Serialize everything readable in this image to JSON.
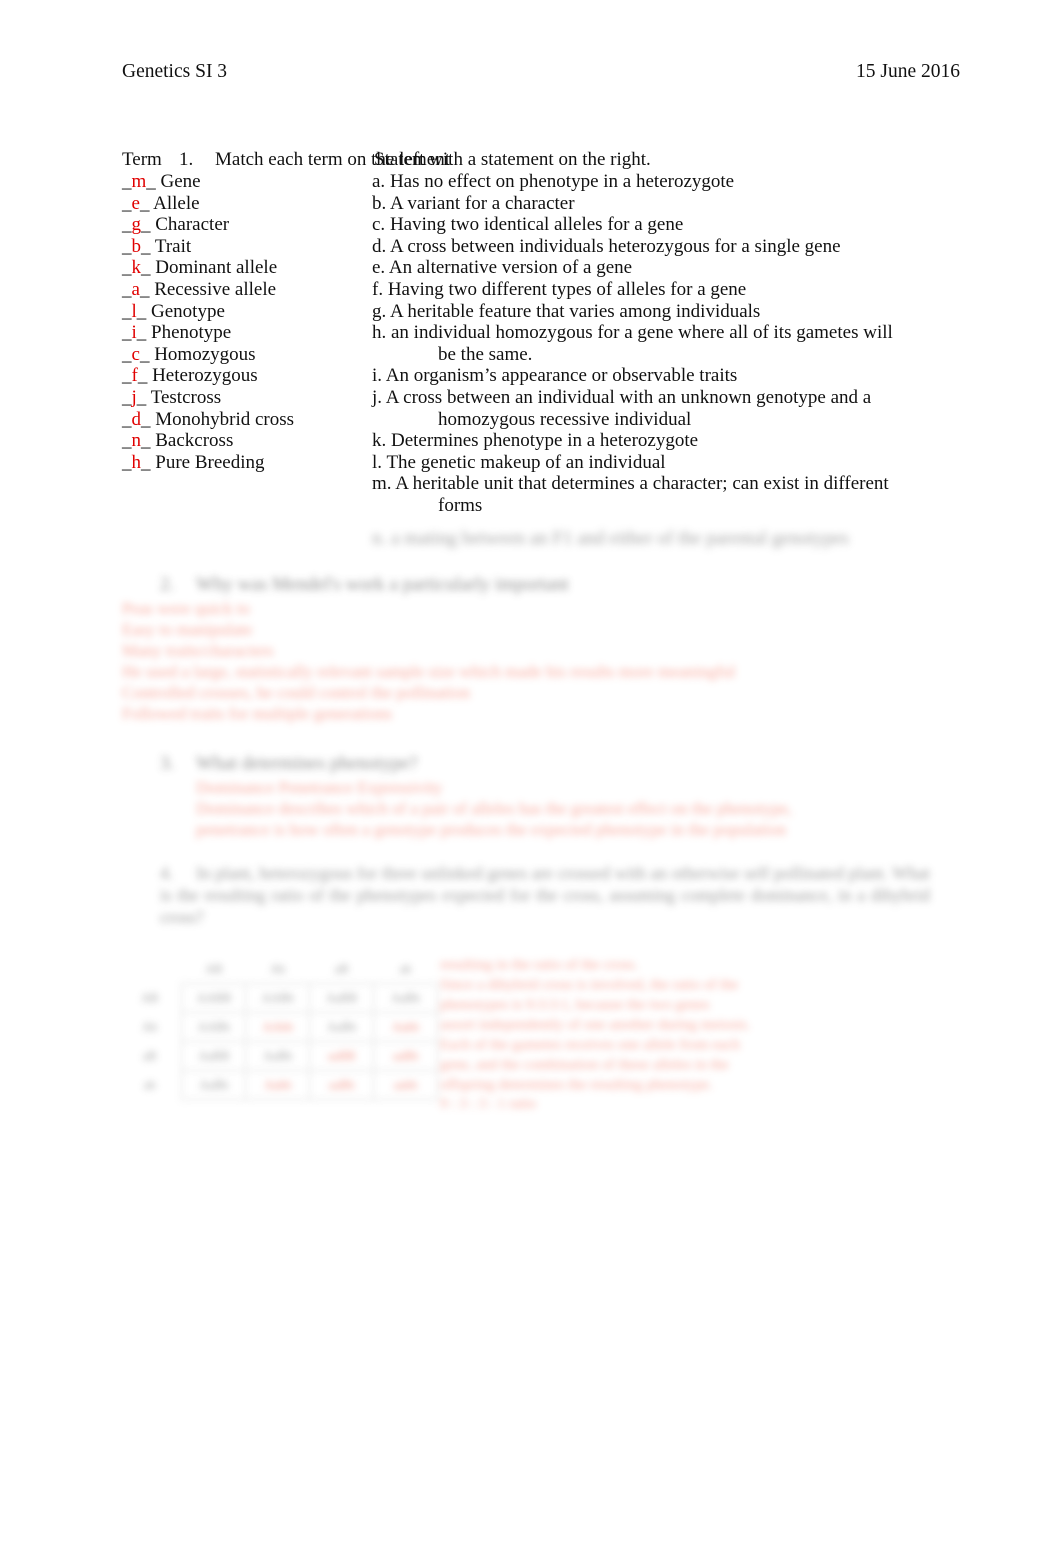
{
  "header": {
    "doc_title": "Genetics SI 3",
    "date": "15 June 2016"
  },
  "question1": {
    "number": "1.",
    "prompt": "Match each term on the left with a statement on the right.",
    "term_column_header": "Term",
    "statement_column_header": "Statement",
    "terms": [
      {
        "answer": "m",
        "label": "Gene"
      },
      {
        "answer": "e",
        "label": "Allele"
      },
      {
        "answer": "g",
        "label": "Character"
      },
      {
        "answer": "b",
        "label": "Trait"
      },
      {
        "answer": "k",
        "label": "Dominant allele"
      },
      {
        "answer": "a",
        "label": "Recessive allele"
      },
      {
        "answer": "l",
        "label": "Genotype"
      },
      {
        "answer": "i",
        "label": "Phenotype"
      },
      {
        "answer": "c",
        "label": "Homozygous"
      },
      {
        "answer": "f",
        "label": "Heterozygous"
      },
      {
        "answer": "j",
        "label": "Testcross"
      },
      {
        "answer": "d",
        "label": "Monohybrid cross"
      },
      {
        "answer": "n",
        "label": "Backcross"
      },
      {
        "answer": "h",
        "label": "Pure Breeding"
      }
    ],
    "statements": [
      {
        "letter": "a.",
        "text": "Has no effect on phenotype in a heterozygote",
        "continuation": ""
      },
      {
        "letter": "b.",
        "text": "A variant for a character",
        "continuation": ""
      },
      {
        "letter": "c.",
        "text": "Having two identical alleles for a gene",
        "continuation": ""
      },
      {
        "letter": "d.",
        "text": "A cross between individuals heterozygous for a single gene",
        "continuation": ""
      },
      {
        "letter": "e.",
        "text": "An alternative version of a gene",
        "continuation": ""
      },
      {
        "letter": "f.",
        "text": "Having two different types of alleles for a gene",
        "continuation": ""
      },
      {
        "letter": "g.",
        "text": "A heritable feature that varies among individuals",
        "continuation": ""
      },
      {
        "letter": "h.",
        "text": "an individual homozygous for a gene where all of its gametes will",
        "continuation": "be the same."
      },
      {
        "letter": "i.",
        "text": "An organism’s appearance or observable traits",
        "continuation": ""
      },
      {
        "letter": "j.",
        "text": "A cross between an individual with an unknown genotype and a",
        "continuation": "homozygous recessive individual"
      },
      {
        "letter": "k.",
        "text": "Determines phenotype in a heterozygote",
        "continuation": ""
      },
      {
        "letter": "l.",
        "text": "The genetic makeup of an individual",
        "continuation": ""
      },
      {
        "letter": "m.",
        "text": "A heritable unit that determines a character; can exist in different",
        "continuation": "forms"
      }
    ],
    "statement_n_obscured": "n. a mating between an F1 and either of the parental genotypes"
  },
  "obscured": {
    "note": "Lower portion of the page is blurred in the source image and not legible.",
    "question2": {
      "number": "2.",
      "prompt_obscured": "Why was Mendel's work a particularly important",
      "answer_lines_obscured": [
        "Peas were quick to",
        "Easy to manipulate",
        "Many traits/characters",
        "He used a large, statistically relevant sample size which made his results more meaningful",
        "Controlled crosses, he could control the pollination",
        "Followed traits for multiple generations"
      ]
    },
    "question3": {
      "number": "3.",
      "prompt_obscured": "What determines phenotype?",
      "answer_lines_obscured": [
        "Dominance   Penetrance   Expressivity",
        "Dominance describes which of a pair of alleles has the greatest effect on the phenotype,",
        "penetrance is how often a genotype produces the expected phenotype in the population"
      ]
    },
    "question4": {
      "number": "4.",
      "prompt_obscured": "In plant, heterozygous for three unlinked genes are crossed with an otherwise self pollinated plant. What is the resulting ratio of the phenotypes expected for the cross, assuming complete dominance, in a dihybrid cross?",
      "highlight_obscured": "dihybrid cross"
    },
    "punnett": {
      "column_headers": [
        "AB",
        "Ab",
        "aB",
        "ab"
      ],
      "row_headers": [
        "AB",
        "Ab",
        "aB",
        "ab"
      ],
      "cells": [
        [
          "AABB",
          "AABb",
          "AaBB",
          "AaBb"
        ],
        [
          "AABb",
          "AAbb",
          "AaBb",
          "Aabb"
        ],
        [
          "AaBB",
          "AaBb",
          "aaBB",
          "aaBb"
        ],
        [
          "AaBb",
          "Aabb",
          "aaBb",
          "aabb"
        ]
      ],
      "highlighted_cells": [
        [
          1,
          1
        ],
        [
          1,
          3
        ],
        [
          2,
          2
        ],
        [
          2,
          3
        ],
        [
          3,
          1
        ],
        [
          3,
          2
        ],
        [
          3,
          3
        ]
      ]
    },
    "side_note_obscured": [
      "resulting in the ratio of the cross.",
      "Since a dihybrid cross is involved, the ratio of the",
      "phenotypes is 9:3:3:1, because the two genes",
      "assort independently of one another during meiosis.",
      "Each of the gametes receives one allele from each",
      "gene, and the combination of these alleles in the",
      "offspring determines the resulting phenotype."
    ],
    "bottom_note_obscured": "9 : 3 : 3 : 1 ratio"
  }
}
